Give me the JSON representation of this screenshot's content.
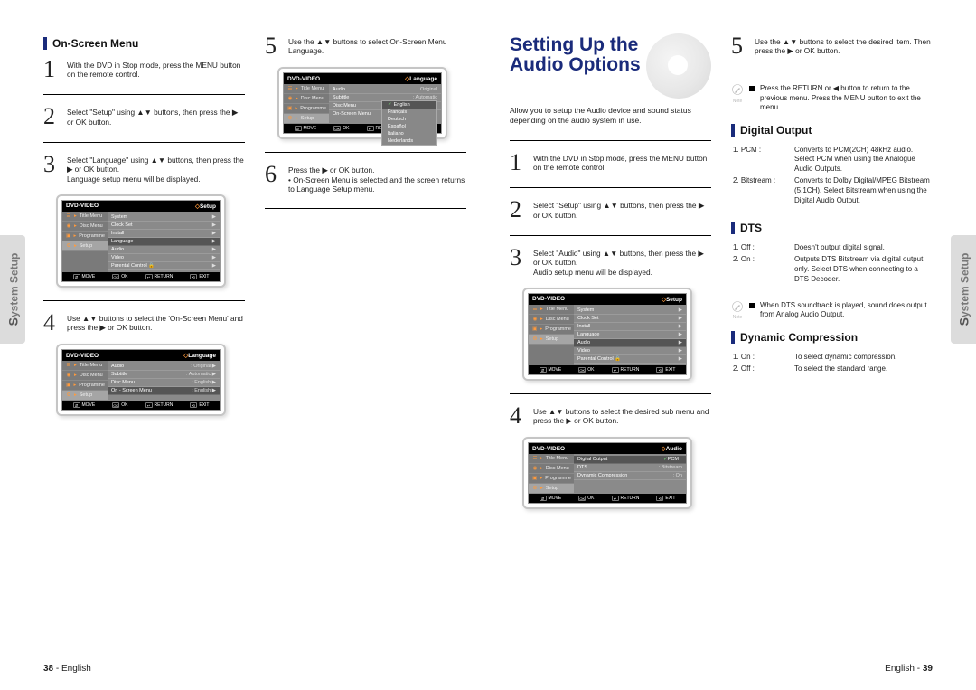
{
  "page_left_num": "38",
  "page_right_num": "39",
  "lang": "English",
  "side_tab": "System Setup",
  "left": {
    "heading": "On-Screen Menu",
    "steps": [
      "With the DVD in Stop mode, press the MENU button on the remote control.",
      "Select \"Setup\" using ▲▼ buttons, then press the ▶ or OK button.",
      "Select \"Language\" using ▲▼ buttons, then press the ▶ or OK button.\nLanguage setup menu will be displayed.",
      "Use ▲▼ buttons to select the 'On-Screen Menu' and press the ▶ or OK button.",
      "Use the ▲▼ buttons to select On-Screen Menu Language.",
      "Press the ▶ or OK button.\n• On-Screen Menu is selected and the screen returns to Language Setup menu."
    ],
    "osd1": {
      "topL": "DVD-VIDEO",
      "topR": "Setup",
      "side": [
        "Title Menu",
        "Disc Menu",
        "Programme",
        "Setup"
      ],
      "rows": [
        {
          "k": "System",
          "v": "▶"
        },
        {
          "k": "Clock Set",
          "v": "▶"
        },
        {
          "k": "Install",
          "v": "▶"
        },
        {
          "k": "Language",
          "v": "▶",
          "sel": true
        },
        {
          "k": "Audio",
          "v": "▶"
        },
        {
          "k": "Video",
          "v": "▶"
        },
        {
          "k": "Parental Control  🔒",
          "v": "▶"
        }
      ],
      "foot": [
        "MOVE",
        "OK",
        "RETURN",
        "EXIT"
      ]
    },
    "osd2": {
      "topL": "DVD-VIDEO",
      "topR": "Language",
      "side": [
        "Title Menu",
        "Disc Menu",
        "Programme",
        "Setup"
      ],
      "rows": [
        {
          "k": "Audio",
          "v": ": Original   ▶"
        },
        {
          "k": "Subtitle",
          "v": ": Automatic   ▶"
        },
        {
          "k": "Disc Menu",
          "v": ": English   ▶"
        },
        {
          "k": "On - Screen Menu",
          "v": ": English   ▶",
          "sel": true
        }
      ],
      "foot": [
        "MOVE",
        "OK",
        "RETURN",
        "EXIT"
      ]
    },
    "osd3": {
      "topL": "DVD-VIDEO",
      "topR": "Language",
      "side": [
        "Title Menu",
        "Disc Menu",
        "Programme",
        "Setup"
      ],
      "rows": [
        {
          "k": "Audio",
          "v": ": Original"
        },
        {
          "k": "Subtitle",
          "v": ": Automatic"
        },
        {
          "k": "Disc Menu",
          "v": ": English"
        },
        {
          "k": "On-Screen Menu",
          "v": ""
        }
      ],
      "drop": [
        "English",
        "Français",
        "Deutsch",
        "Español",
        "Italiano",
        "Nederlands"
      ],
      "drop_sel": 0,
      "foot": [
        "MOVE",
        "OK",
        "RETURN",
        "EXIT"
      ]
    }
  },
  "right": {
    "big_title": "Setting Up the Audio Options",
    "intro": "Allow you to setup the Audio device and sound status depending on the audio system in use.",
    "steps": [
      "With the DVD in Stop mode, press the MENU button on the remote control.",
      "Select \"Setup\" using ▲▼ buttons, then press the ▶ or OK button.",
      "Select \"Audio\" using ▲▼ buttons, then press the ▶ or OK button.\nAudio setup menu will be displayed.",
      "Use ▲▼ buttons to select the desired sub menu and press the ▶ or OK button.",
      "Use the ▲▼ buttons to select the desired item. Then press the ▶ or OK button."
    ],
    "note1": "Press the RETURN or ◀ button to return to the previous menu. Press the MENU button to exit the menu.",
    "digital_output_h": "Digital Output",
    "digital_output": [
      {
        "k": "1. PCM :",
        "v": "Converts to PCM(2CH) 48kHz audio. Select PCM when using the Analogue Audio Outputs."
      },
      {
        "k": "2. Bitstream :",
        "v": "Converts to Dolby Digital/MPEG Bitstream (5.1CH). Select Bitstream when using the Digital Audio Output."
      }
    ],
    "dts_h": "DTS",
    "dts": [
      {
        "k": "1. Off :",
        "v": "Doesn't output digital signal."
      },
      {
        "k": "2. On :",
        "v": "Outputs DTS Bitstream via digital output only. Select DTS when connecting to a DTS Decoder."
      }
    ],
    "note2": "When DTS soundtrack is played, sound does output from Analog Audio Output.",
    "dyn_h": "Dynamic Compression",
    "dyn": [
      {
        "k": "1. On :",
        "v": "To select dynamic compression."
      },
      {
        "k": "2. Off :",
        "v": "To select the standard range."
      }
    ],
    "osd1": {
      "topL": "DVD-VIDEO",
      "topR": "Setup",
      "side": [
        "Title Menu",
        "Disc Menu",
        "Programme",
        "Setup"
      ],
      "rows": [
        {
          "k": "System",
          "v": "▶"
        },
        {
          "k": "Clock Set",
          "v": "▶"
        },
        {
          "k": "Install",
          "v": "▶"
        },
        {
          "k": "Language",
          "v": "▶"
        },
        {
          "k": "Audio",
          "v": "▶",
          "sel": true
        },
        {
          "k": "Video",
          "v": "▶"
        },
        {
          "k": "Parental Control  🔒",
          "v": "▶"
        }
      ],
      "foot": [
        "MOVE",
        "OK",
        "RETURN",
        "EXIT"
      ]
    },
    "osd2": {
      "topL": "DVD-VIDEO",
      "topR": "Audio",
      "side": [
        "Title Menu",
        "Disc Menu",
        "Programme",
        "Setup"
      ],
      "rows": [
        {
          "k": "Digital Output",
          "v": "",
          "sel": true
        },
        {
          "k": "DTS",
          "v": ": Bitstream"
        },
        {
          "k": "Dynamic Compression",
          "v": ": On"
        }
      ],
      "pcmbox": "PCM",
      "foot": [
        "MOVE",
        "OK",
        "RETURN",
        "EXIT"
      ]
    }
  }
}
